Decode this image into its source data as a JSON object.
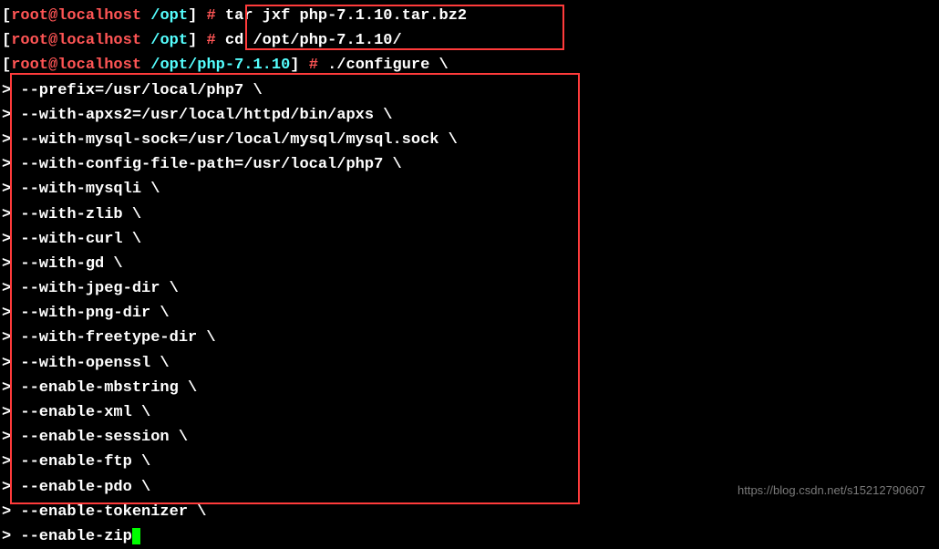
{
  "prompt1": {
    "open": "[",
    "user": "root",
    "at": "@",
    "host": "localhost",
    "dir": " /opt",
    "close": "] ",
    "hash": "# ",
    "cmd": "tar jxf php-7.1.10.tar.bz2"
  },
  "prompt2": {
    "open": "[",
    "user": "root",
    "at": "@",
    "host": "localhost",
    "dir": " /opt",
    "close": "] ",
    "hash": "# ",
    "cmd": "cd /opt/php-7.1.10/"
  },
  "prompt3": {
    "open": "[",
    "user": "root",
    "at": "@",
    "host": "localhost",
    "dir": " /opt/php-7.1.10",
    "close": "] ",
    "hash": "# ",
    "cmd": "./configure \\"
  },
  "lines": [
    "> --prefix=/usr/local/php7 \\",
    "> --with-apxs2=/usr/local/httpd/bin/apxs \\",
    "> --with-mysql-sock=/usr/local/mysql/mysql.sock \\",
    "> --with-config-file-path=/usr/local/php7 \\",
    "> --with-mysqli \\",
    "> --with-zlib \\",
    "> --with-curl \\",
    "> --with-gd \\",
    "> --with-jpeg-dir \\",
    "> --with-png-dir \\",
    "> --with-freetype-dir \\",
    "> --with-openssl \\",
    "> --enable-mbstring \\",
    "> --enable-xml \\",
    "> --enable-session \\",
    "> --enable-ftp \\",
    "> --enable-pdo \\",
    "> --enable-tokenizer \\",
    "> --enable-zip"
  ],
  "watermark": "https://blog.csdn.net/s15212790607"
}
